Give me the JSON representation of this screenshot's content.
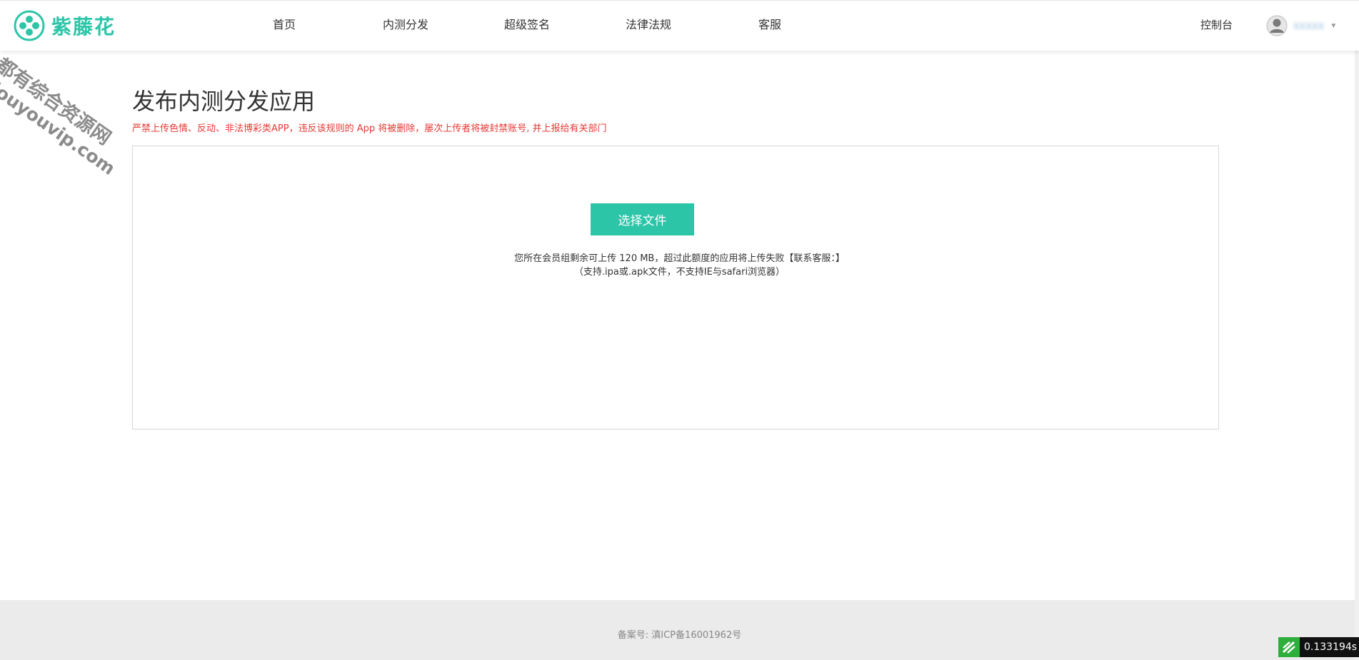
{
  "brand": {
    "logo_text": "紫藤花",
    "accent_color": "#2cc5a8",
    "logo_icon": "flower-logo-icon"
  },
  "nav": {
    "items": [
      {
        "label": "首页"
      },
      {
        "label": "内测分发"
      },
      {
        "label": "超级签名"
      },
      {
        "label": "法律法规"
      },
      {
        "label": "客服"
      }
    ],
    "console_label": "控制台",
    "user": {
      "name": "XXXXX",
      "avatar_icon": "user-avatar-icon",
      "caret_icon": "chevron-down-icon"
    }
  },
  "main": {
    "title": "发布内测分发应用",
    "warning": "严禁上传色情、反动、非法博彩类APP，违反该规则的 App 将被删除，屡次上传者将被封禁账号, 并上报给有关部门",
    "warning_color": "#e53935",
    "upload": {
      "button_label": "选择文件",
      "quota_text": "您所在会员组剩余可上传 120 MB，超过此额度的应用将上传失败【联系客服：】",
      "support_text": "（支持.ipa或.apk文件，不支持IE与safari浏览器）"
    }
  },
  "watermark": {
    "line1": "都有综合资源网",
    "line2": "douyouvip.com"
  },
  "footer": {
    "icp": "备案号: 滇ICP备16001962号"
  },
  "debug": {
    "timer": "0.133194s",
    "icon": "leaf-icon"
  }
}
